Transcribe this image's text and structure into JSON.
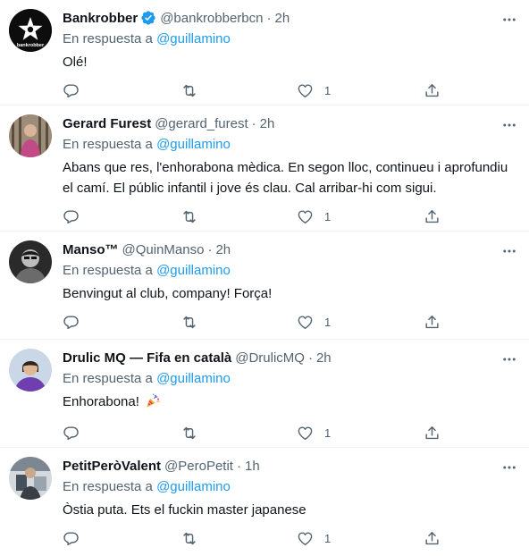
{
  "reply_prefix": "En respuesta a",
  "separator": "·",
  "colors": {
    "link": "#1d9bf0",
    "muted": "#536471",
    "text": "#0f1419",
    "verified": "#1d9bf0"
  },
  "tweets": [
    {
      "name": "Bankrobber",
      "verified": true,
      "handle": "@bankrobberbcn",
      "time": "2h",
      "reply_to": "@guillamino",
      "text": "Olé!",
      "likes": "1",
      "avatar_icon": "star-logo",
      "avatar_text": "bankrobber"
    },
    {
      "name": "Gerard Furest",
      "verified": false,
      "handle": "@gerard_furest",
      "time": "2h",
      "reply_to": "@guillamino",
      "text": "Abans que res, l'enhorabona mèdica. En segon lloc, continueu i aprofundiu el camí. El públic infantil i jove és clau. Cal arribar-hi com sigui.",
      "likes": "1",
      "avatar_icon": "person-photo"
    },
    {
      "name": "Manso™",
      "verified": false,
      "handle": "@QuinManso",
      "time": "2h",
      "reply_to": "@guillamino",
      "text": "Benvingut al club, company! Força!",
      "likes": "1",
      "avatar_icon": "person-photo"
    },
    {
      "name": "Drulic MQ — Fifa en català",
      "verified": false,
      "handle": "@DrulicMQ",
      "time": "2h",
      "reply_to": "@guillamino",
      "text": "Enhorabona!",
      "emoji_icon": "party-popper-icon",
      "likes": "1",
      "avatar_icon": "person-photo"
    },
    {
      "name": "PetitPeròValent",
      "verified": false,
      "handle": "@PeroPetit",
      "time": "1h",
      "reply_to": "@guillamino",
      "text": "Òstia puta. Ets el fuckin master japanese",
      "likes": "1",
      "avatar_icon": "person-photo"
    }
  ]
}
